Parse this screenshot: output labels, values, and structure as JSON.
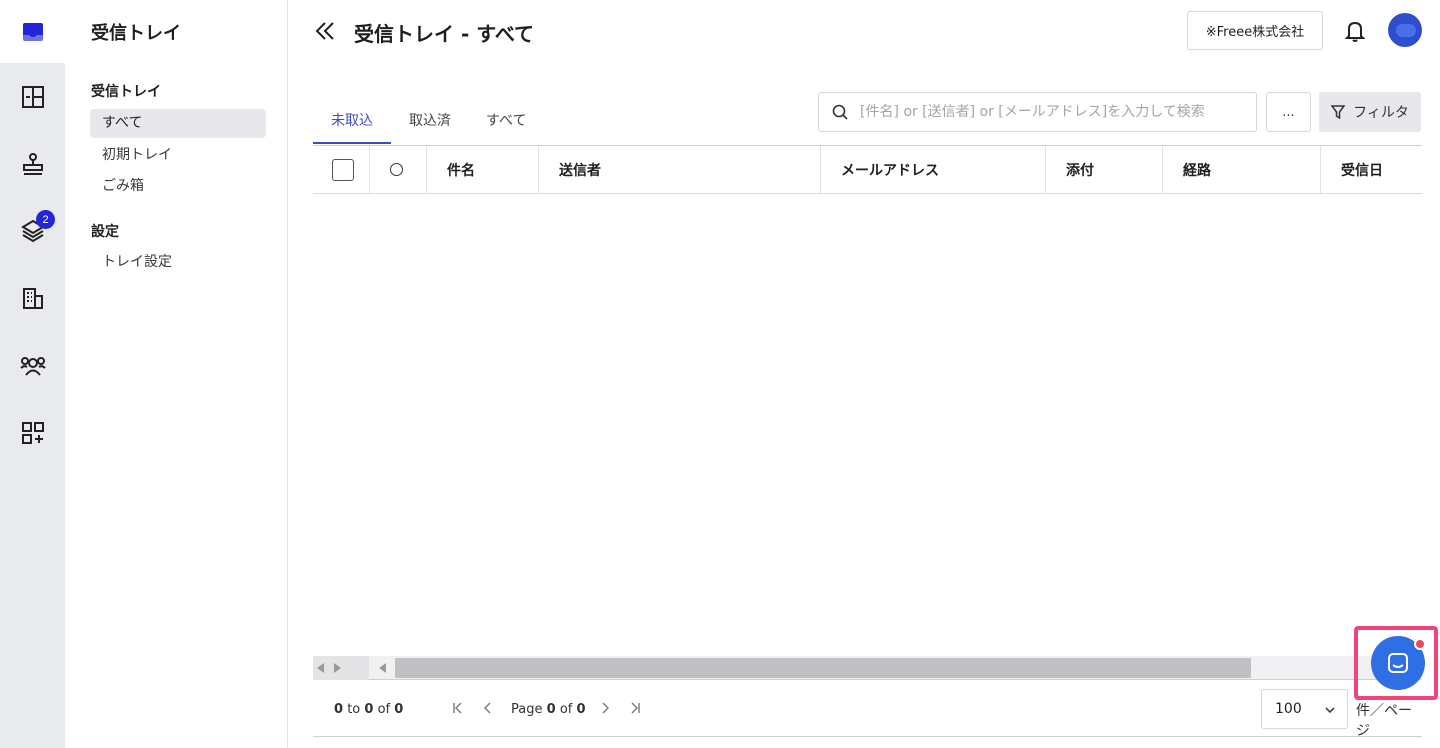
{
  "rail": {
    "icons": [
      "inbox-logo-icon",
      "dashboard-icon",
      "stamp-icon",
      "layers-icon",
      "building-icon",
      "users-icon",
      "add-app-icon"
    ],
    "badge_count": "2",
    "accent": "#2424d8"
  },
  "sidebar": {
    "title": "受信トレイ",
    "section_inbox": "受信トレイ",
    "items": [
      {
        "label": "すべて",
        "active": true
      },
      {
        "label": "初期トレイ"
      },
      {
        "label": "ごみ箱"
      }
    ],
    "section_settings": "設定",
    "settings_items": [
      {
        "label": "トレイ設定"
      }
    ]
  },
  "header": {
    "title": "受信トレイ - すべて",
    "company": "※Freee株式会社"
  },
  "tabs": [
    {
      "label": "未取込",
      "active": true
    },
    {
      "label": "取込済"
    },
    {
      "label": "すべて"
    }
  ],
  "search": {
    "placeholder": "[件名] or [送信者] or [メールアドレス]を入力して検索",
    "value": ""
  },
  "toolbar": {
    "more_label": "...",
    "filter_label": "フィルタ"
  },
  "table": {
    "columns": [
      "件名",
      "送信者",
      "メールアドレス",
      "添付",
      "経路",
      "受信日"
    ],
    "rows": []
  },
  "pagination": {
    "range_from": "0",
    "range_to": "0",
    "range_total": "0",
    "to_word": "to",
    "of_word": "of",
    "page_word": "Page",
    "page_current": "0",
    "page_total": "0",
    "per_page": "100",
    "per_page_unit": "件／ページ"
  },
  "colors": {
    "primary": "#3b4cc0",
    "chat": "#2f6fe6",
    "highlight": "#f0457a"
  }
}
